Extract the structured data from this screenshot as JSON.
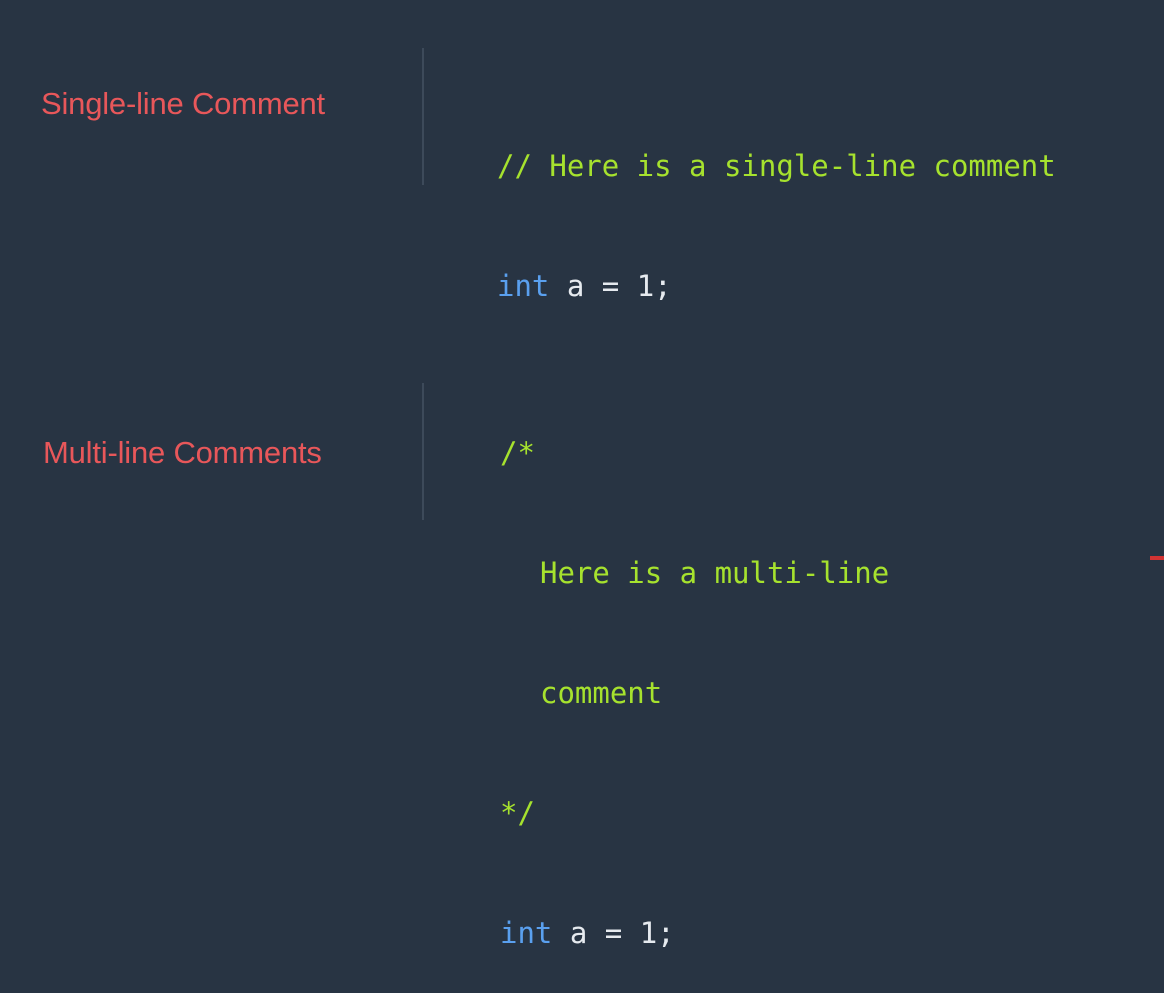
{
  "single_line": {
    "title": "Single-line Comment",
    "comment": "// Here is a single-line comment",
    "code": {
      "keyword": "int",
      "rest": " a = 1;"
    }
  },
  "multi_line": {
    "title": "Multi-line Comments",
    "open": "/*",
    "body_lines": [
      "Here is a multi-line",
      "comment"
    ],
    "close": "*/",
    "code": {
      "keyword": "int",
      "rest": " a = 1;"
    }
  },
  "colors": {
    "background": "#283443",
    "label": "#e8575a",
    "comment": "#a6e22e",
    "keyword": "#5aa0ef",
    "text": "#e6eaef",
    "divider": "#3d4a5a"
  }
}
